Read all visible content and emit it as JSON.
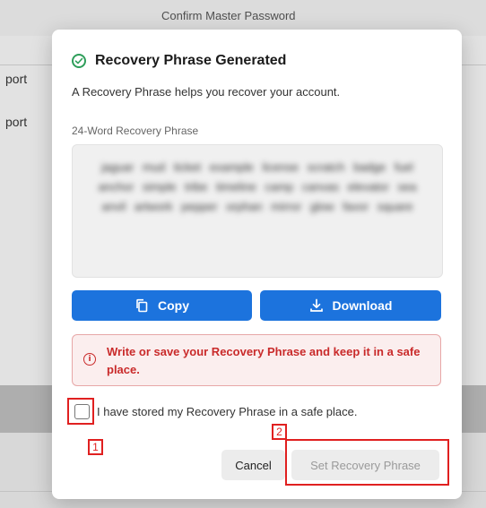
{
  "background": {
    "field_title": "Confirm Master Password",
    "side_items": [
      "port",
      "port"
    ]
  },
  "modal": {
    "title": "Recovery Phrase Generated",
    "description": "A Recovery Phrase helps you recover your account.",
    "phrase_label": "24-Word Recovery Phrase",
    "phrase_blurred": "jaguar mud ticket example license scratch badge fuel anchor simple tribe timeline camp canvas elevator sea anvil artwork pepper orphan mirror glow favor square",
    "copy_label": "Copy",
    "download_label": "Download",
    "warning_text": "Write or save your Recovery Phrase and keep it in a safe place.",
    "checkbox_label": "I have stored my Recovery Phrase in a safe place.",
    "cancel_label": "Cancel",
    "set_label": "Set Recovery Phrase"
  },
  "annotations": [
    "1",
    "2"
  ],
  "colors": {
    "primary": "#1c73dd",
    "warning": "#c92a2a",
    "success": "#2e9e5a",
    "annotation": "#e02020"
  },
  "icons": {
    "title": "check-circle-icon",
    "copy": "copy-icon",
    "download": "download-icon",
    "warning": "info-circle-icon"
  }
}
